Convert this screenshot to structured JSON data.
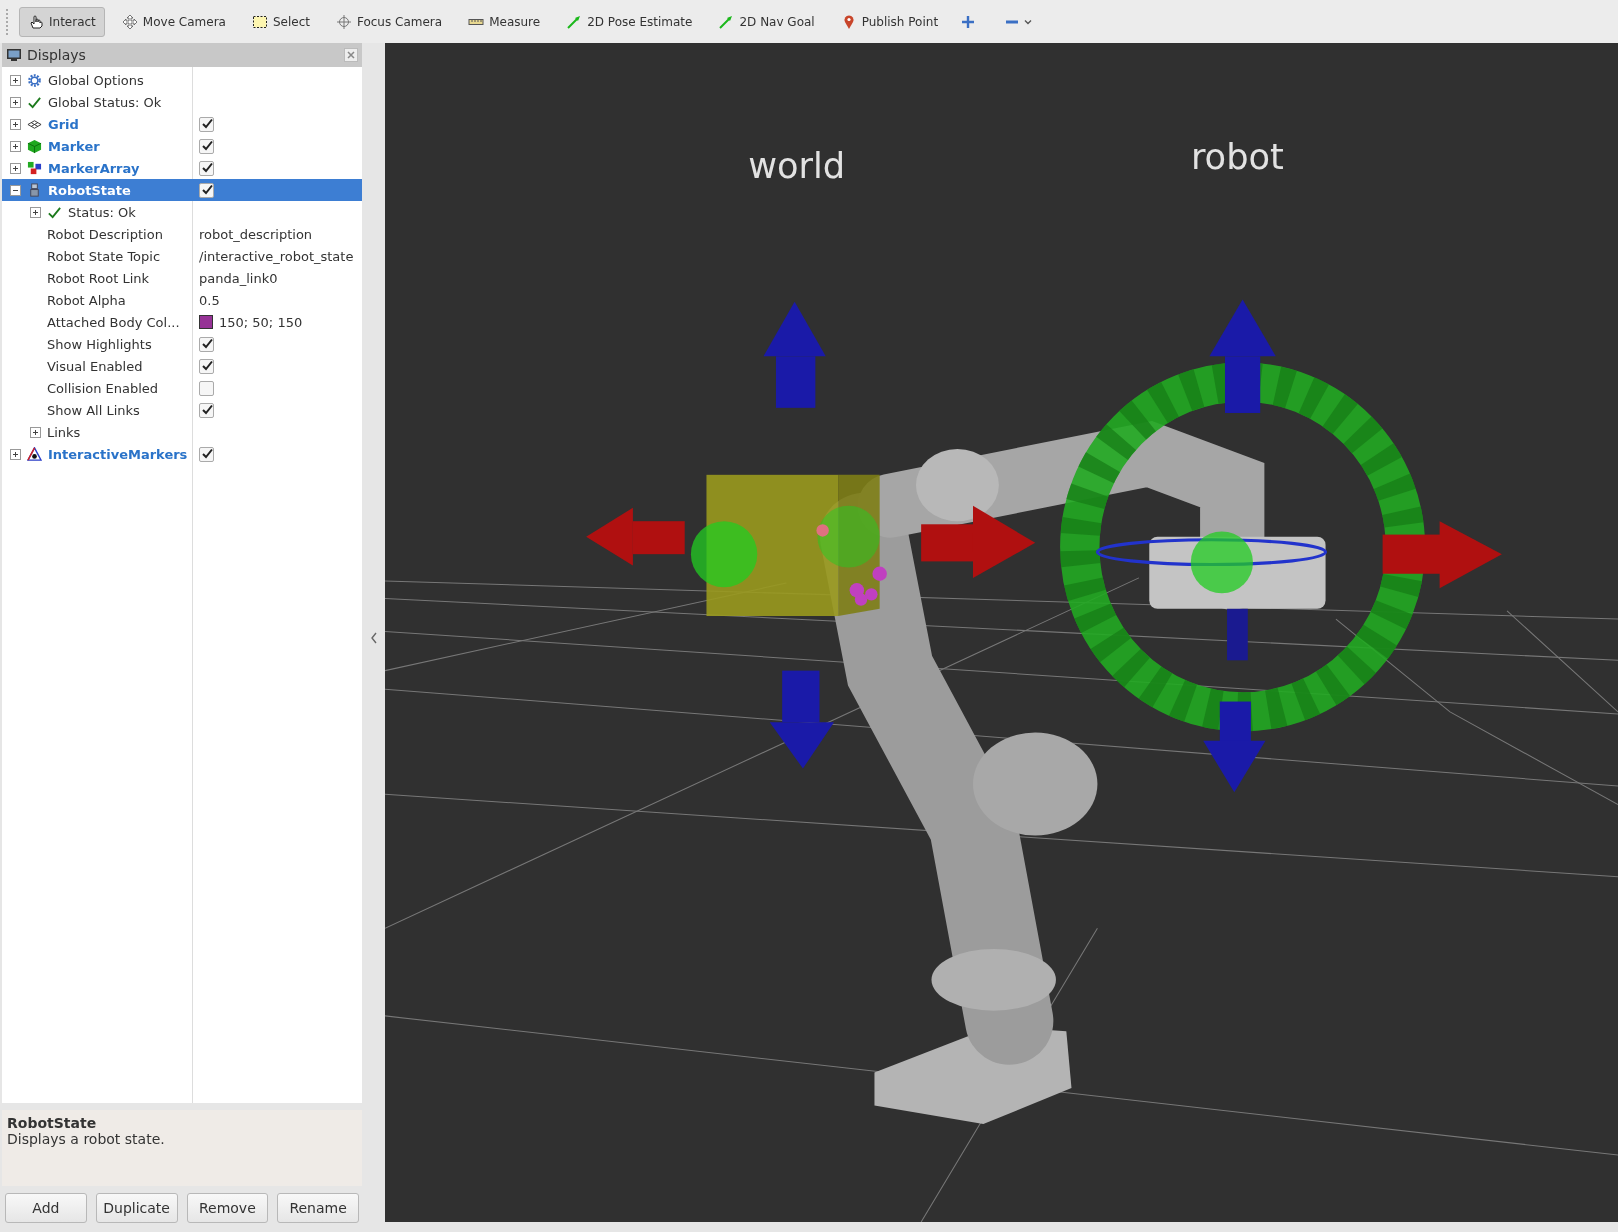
{
  "toolbar": {
    "tools": [
      {
        "label": "Interact",
        "kind": "interact",
        "selected": true
      },
      {
        "label": "Move Camera",
        "kind": "move",
        "selected": false
      },
      {
        "label": "Select",
        "kind": "select",
        "selected": false
      },
      {
        "label": "Focus Camera",
        "kind": "focus",
        "selected": false
      },
      {
        "label": "Measure",
        "kind": "measure",
        "selected": false
      },
      {
        "label": "2D Pose Estimate",
        "kind": "pose",
        "selected": false
      },
      {
        "label": "2D Nav Goal",
        "kind": "nav",
        "selected": false
      },
      {
        "label": "Publish Point",
        "kind": "point",
        "selected": false
      }
    ]
  },
  "displays": {
    "title": "Displays",
    "items": [
      {
        "label": "Global Options",
        "kind": "options",
        "expanded": false,
        "selected": false
      },
      {
        "label": "Global Status: Ok",
        "kind": "status",
        "expanded": false,
        "selected": false
      },
      {
        "label": "Grid",
        "kind": "grid",
        "expanded": false,
        "checked": true,
        "selected": false
      },
      {
        "label": "Marker",
        "kind": "marker",
        "expanded": false,
        "checked": true,
        "selected": false
      },
      {
        "label": "MarkerArray",
        "kind": "markerarray",
        "expanded": false,
        "checked": true,
        "selected": false
      },
      {
        "label": "RobotState",
        "kind": "robot",
        "expanded": true,
        "checked": true,
        "selected": true,
        "children": [
          {
            "label": "Status: Ok",
            "kind": "status",
            "expanded": false,
            "selected": false
          },
          {
            "label": "Robot Description",
            "kind": "property",
            "value": "robot_description",
            "selected": false
          },
          {
            "label": "Robot State Topic",
            "kind": "property",
            "value": "/interactive_robot_state",
            "selected": false
          },
          {
            "label": "Robot Root Link",
            "kind": "property",
            "value": "panda_link0",
            "selected": false
          },
          {
            "label": "Robot Alpha",
            "kind": "property",
            "value": "0.5",
            "selected": false
          },
          {
            "label": "Attached Body Col...",
            "kind": "property",
            "value": "150; 50; 150",
            "color": "#963296",
            "selected": false
          },
          {
            "label": "Show Highlights",
            "kind": "property",
            "checked": true,
            "selected": false
          },
          {
            "label": "Visual Enabled",
            "kind": "property",
            "checked": true,
            "selected": false
          },
          {
            "label": "Collision Enabled",
            "kind": "property",
            "checked": false,
            "selected": false
          },
          {
            "label": "Show All Links",
            "kind": "property",
            "checked": true,
            "selected": false
          },
          {
            "label": "Links",
            "kind": "property",
            "expanded": false,
            "selected": false
          }
        ]
      },
      {
        "label": "InteractiveMarkers",
        "kind": "interactive",
        "expanded": false,
        "checked": true,
        "selected": false
      }
    ]
  },
  "description": {
    "title": "RobotState",
    "text": "Displays a robot state."
  },
  "buttons": [
    "Add",
    "Duplicate",
    "Remove",
    "Rename"
  ],
  "viewport": {
    "frame_labels": [
      {
        "text": "world"
      },
      {
        "text": "robot"
      }
    ]
  }
}
